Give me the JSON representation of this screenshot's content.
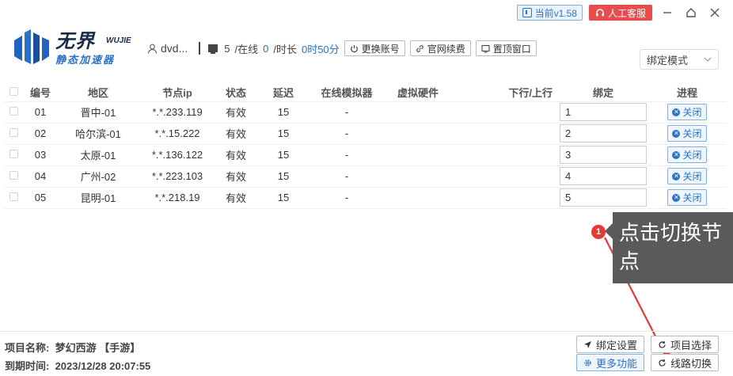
{
  "titlebar": {
    "version": "当前v1.58",
    "service": "人工客服"
  },
  "brand": {
    "name_cn": "无界",
    "name_en": "WUJIE",
    "subtitle": "静态加速器"
  },
  "user": {
    "name": "dvd..."
  },
  "stats": {
    "count": "5",
    "online_label": "/在线",
    "online": "0",
    "duration_label": "/时长",
    "duration": "0时50分"
  },
  "header_buttons": {
    "switch_account": "更换账号",
    "renew": "官网续费",
    "pin_top": "置顶窗口"
  },
  "mode_select": {
    "value": "绑定模式"
  },
  "table": {
    "columns": [
      "编号",
      "地区",
      "节点ip",
      "状态",
      "延迟",
      "在线模拟器",
      "虚拟硬件",
      "下行/上行",
      "绑定",
      "进程"
    ],
    "rows": [
      {
        "id": "01",
        "region": "晋中-01",
        "ip": "*.*.233.119",
        "status": "有效",
        "latency": "15",
        "emu": "-",
        "bind": "1",
        "action": "关闭"
      },
      {
        "id": "02",
        "region": "哈尔滨-01",
        "ip": "*.*.15.222",
        "status": "有效",
        "latency": "15",
        "emu": "-",
        "bind": "2",
        "action": "关闭"
      },
      {
        "id": "03",
        "region": "太原-01",
        "ip": "*.*.136.122",
        "status": "有效",
        "latency": "15",
        "emu": "-",
        "bind": "3",
        "action": "关闭"
      },
      {
        "id": "04",
        "region": "广州-02",
        "ip": "*.*.223.103",
        "status": "有效",
        "latency": "15",
        "emu": "-",
        "bind": "4",
        "action": "关闭"
      },
      {
        "id": "05",
        "region": "昆明-01",
        "ip": "*.*.218.19",
        "status": "有效",
        "latency": "15",
        "emu": "-",
        "bind": "5",
        "action": "关闭"
      }
    ]
  },
  "annotation": {
    "marker": "1",
    "text": "点击切换节点"
  },
  "footer": {
    "project_label": "项目名称:",
    "project_value": "梦幻西游 【手游】",
    "expire_label": "到期时间:",
    "expire_value": "2023/12/28 20:07:55",
    "bind_settings": "绑定设置",
    "project_select": "项目选择",
    "more": "更多功能",
    "line_switch": "线路切换"
  }
}
